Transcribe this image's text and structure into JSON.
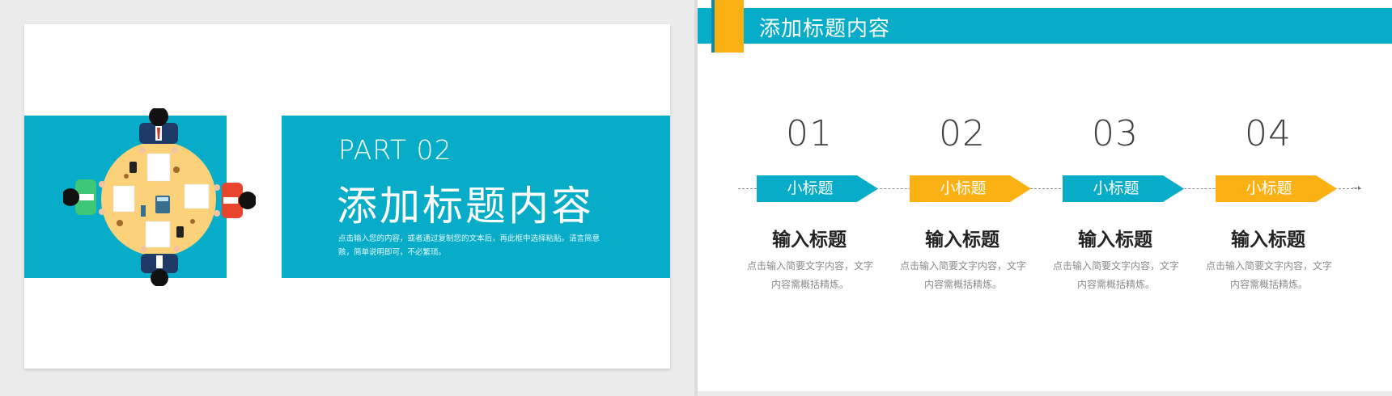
{
  "left_slide": {
    "part_label": "PART 02",
    "title": "添加标题内容",
    "description": "点击输入您的内容，或者通过复制您的文本后，再此框中选择粘贴。请言简意赅，简单说明即可，不必繁琐。",
    "illustration": "meeting-table-icon"
  },
  "right_slide": {
    "header_title": "添加标题内容",
    "steps": [
      {
        "number": "01",
        "tag": "小标题",
        "tag_color": "#07adc8",
        "heading": "输入标题",
        "desc": "点击输入简要文字内容，文字内容需概括精炼。"
      },
      {
        "number": "02",
        "tag": "小标题",
        "tag_color": "#fbb013",
        "heading": "输入标题",
        "desc": "点击输入简要文字内容，文字内容需概括精炼。"
      },
      {
        "number": "03",
        "tag": "小标题",
        "tag_color": "#07adc8",
        "heading": "输入标题",
        "desc": "点击输入简要文字内容，文字内容需概括精炼。"
      },
      {
        "number": "04",
        "tag": "小标题",
        "tag_color": "#fbb013",
        "heading": "输入标题",
        "desc": "点击输入简要文字内容，文字内容需概括精炼。"
      }
    ]
  },
  "colors": {
    "teal": "#07adc8",
    "orange": "#fbb013",
    "text_dark": "#222222",
    "text_gray": "#8a8a8a"
  }
}
